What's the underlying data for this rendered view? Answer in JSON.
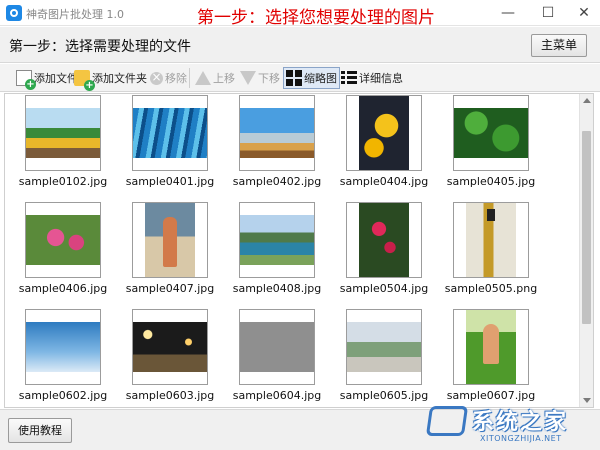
{
  "window": {
    "title": "神奇图片批处理 1.0",
    "banner": "第一步：选择您想要处理的图片",
    "controls": {
      "minimize": "—",
      "maximize": "☐",
      "close": "✕"
    }
  },
  "header": {
    "step_title": "第一步：选择需要处理的文件",
    "main_menu_label": "主菜单"
  },
  "toolbar": {
    "add_file": "添加文件",
    "add_folder": "添加文件夹",
    "remove": "移除",
    "move_up": "上移",
    "move_down": "下移",
    "thumbnail": "缩略图",
    "details": "详细信息"
  },
  "files": [
    {
      "name": "sample0102.jpg",
      "orientation": "land"
    },
    {
      "name": "sample0401.jpg",
      "orientation": "land"
    },
    {
      "name": "sample0402.jpg",
      "orientation": "land"
    },
    {
      "name": "sample0404.jpg",
      "orientation": "port"
    },
    {
      "name": "sample0405.jpg",
      "orientation": "land"
    },
    {
      "name": "sample0406.jpg",
      "orientation": "land"
    },
    {
      "name": "sample0407.jpg",
      "orientation": "port"
    },
    {
      "name": "sample0408.jpg",
      "orientation": "land"
    },
    {
      "name": "sample0504.jpg",
      "orientation": "port"
    },
    {
      "name": "sample0505.png",
      "orientation": "port"
    },
    {
      "name": "sample0602.jpg",
      "orientation": "land"
    },
    {
      "name": "sample0603.jpg",
      "orientation": "land"
    },
    {
      "name": "sample0604.jpg",
      "orientation": "land"
    },
    {
      "name": "sample0605.jpg",
      "orientation": "land"
    },
    {
      "name": "sample0607.jpg",
      "orientation": "port"
    }
  ],
  "footer": {
    "tutorial_label": "使用教程"
  },
  "watermark": {
    "text": "系统之家",
    "url": "XITONGZHIJIA.NET"
  },
  "colors": {
    "banner_red": "#e00000",
    "app_icon_blue": "#1e88e5",
    "watermark_blue": "#3a78c2"
  }
}
